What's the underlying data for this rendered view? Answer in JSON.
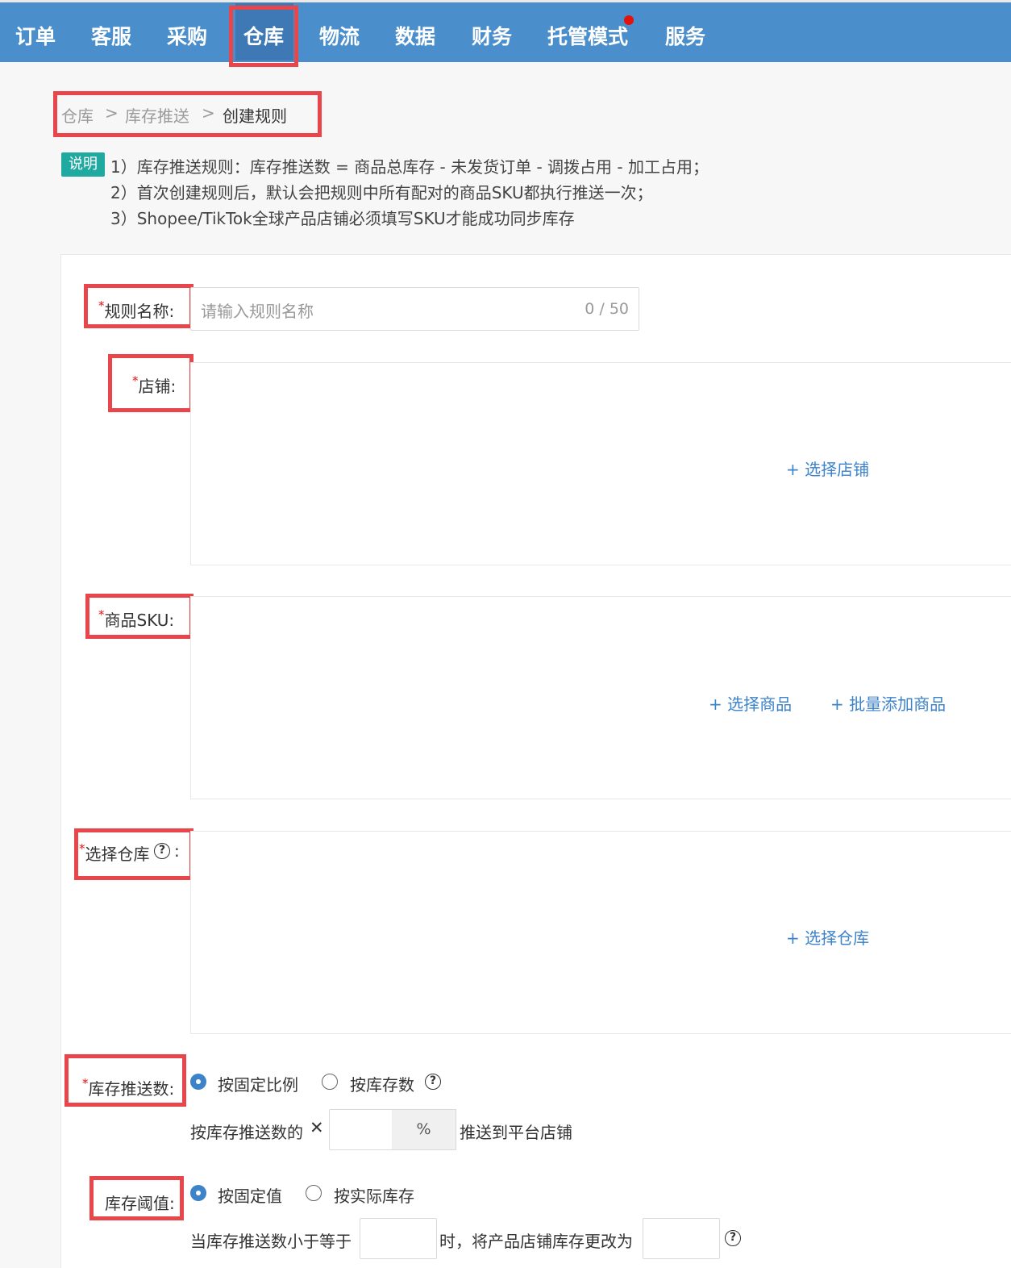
{
  "nav": {
    "items": [
      "订单",
      "客服",
      "采购",
      "仓库",
      "物流",
      "数据",
      "财务",
      "托管模式",
      "服务"
    ],
    "active": "仓库"
  },
  "breadcrumb": {
    "items": [
      "仓库",
      "库存推送",
      "创建规则"
    ],
    "separator": ">"
  },
  "notes": {
    "tag": "说明",
    "lines": [
      "1）库存推送规则：库存推送数 = 商品总库存 - 未发货订单 - 调拨占用 - 加工占用；",
      "2）首次创建规则后，默认会把规则中所有配对的商品SKU都执行推送一次；",
      "3）Shopee/TikTok全球产品店铺必须填写SKU才能成功同步库存"
    ]
  },
  "form": {
    "rule_name": {
      "label": "规则名称",
      "placeholder": "请输入规则名称",
      "counter": "0 / 50",
      "required": "*"
    },
    "shop": {
      "label": "店铺",
      "required": "*",
      "action": "+ 选择店铺"
    },
    "sku": {
      "label": "商品SKU",
      "required": "*",
      "actions": [
        "+ 选择商品",
        "+ 批量添加商品"
      ]
    },
    "warehouse": {
      "label": "选择仓库",
      "required": "*",
      "action": "+ 选择仓库",
      "help_icon": "question-circle-icon"
    },
    "push_count": {
      "label": "库存推送数",
      "required": "*",
      "options": [
        "按固定比例",
        "按库存数"
      ],
      "selected": "按固定比例",
      "ratio_prefix": "按库存推送数的",
      "multiply_symbol": "✕",
      "ratio_value": "",
      "ratio_unit": "%",
      "ratio_suffix": "推送到平台店铺"
    },
    "threshold": {
      "label": "库存阈值",
      "options": [
        "按固定值",
        "按实际库存"
      ],
      "selected": "按固定值",
      "prefix": "当库存推送数小于等于",
      "middle": "时，将产品店铺库存更改为",
      "value1": "",
      "value2": ""
    },
    "colon": ":"
  },
  "colors": {
    "nav_bg": "#4a8fcc",
    "highlight": "#e9464b",
    "link": "#3c83c9",
    "tag": "#1fa9a0"
  }
}
